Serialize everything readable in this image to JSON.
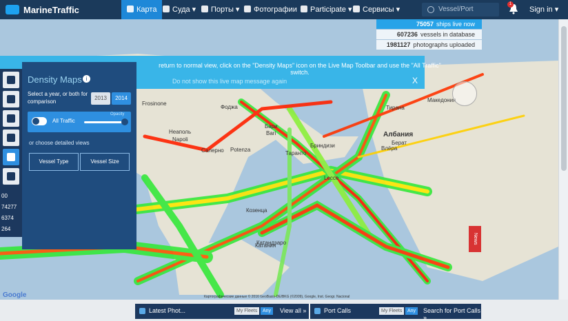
{
  "app": {
    "title": "MarineTraffic"
  },
  "nav": {
    "items": [
      {
        "label": "Карта"
      },
      {
        "label": "Суда"
      },
      {
        "label": "Порты"
      },
      {
        "label": "Фотографии"
      },
      {
        "label": "Participate"
      },
      {
        "label": "Сервисы"
      }
    ],
    "search_placeholder": "Vessel/Port",
    "notification_count": "1",
    "signin_label": "Sign in"
  },
  "stats": {
    "ships_live": {
      "value": "75057",
      "label": "ships live now"
    },
    "vessels_db": {
      "value": "607236",
      "label": "vessels in database"
    },
    "photos": {
      "value": "1981127",
      "label": "photographs uploaded"
    }
  },
  "banner": {
    "text": "return to normal view, click on the \"Density Maps\" icon on the Live Map Toolbar and use the \"All Traffic\" switch.",
    "dismiss_link": "Do not show this live map message again",
    "close": "X"
  },
  "toolbar": {
    "stats": [
      {
        "label": "00"
      },
      {
        "label": "74277"
      },
      {
        "label": "6374"
      },
      {
        "label": "264"
      }
    ]
  },
  "density_panel": {
    "title": "Density Maps",
    "subtitle": "Select a year, or both for comparison",
    "years": [
      "2013",
      "2014"
    ],
    "traffic_label": "All Traffic",
    "opacity_label": "Opacity",
    "choose_label": "or choose detailed views",
    "vessel_type": "Vessel Type",
    "vessel_size": "Vessel Size"
  },
  "map": {
    "labels": [
      "Frosinone",
      "Неаполь",
      "Napoli",
      "Салерно",
      "Potenza",
      "Фоджа",
      "Бари",
      "Bari",
      "Бриндизи",
      "Таранто",
      "Тирана",
      "Албания",
      "Берат",
      "Влёра",
      "Македония",
      "Козенца",
      "Катандзаро",
      "Катания",
      "Lecce"
    ],
    "attribution": "Картографические данные © 2016 GeoBasis-DE/BKG (©2009), Google, Inst. Geogr. Nacional",
    "google": "Google",
    "news_label": "News"
  },
  "bottom": {
    "photos_title": "Latest Phot...",
    "my_fleets": "My Fleets",
    "any": "Any",
    "view_all": "View all »",
    "port_calls_title": "Port Calls",
    "port_search": "Search for Port Calls »"
  },
  "colors": {
    "navbar": "#1b3a5b",
    "accent": "#1e88d8",
    "banner": "#39b5e8",
    "panel": "#1f4c7e",
    "news": "#d83333"
  }
}
